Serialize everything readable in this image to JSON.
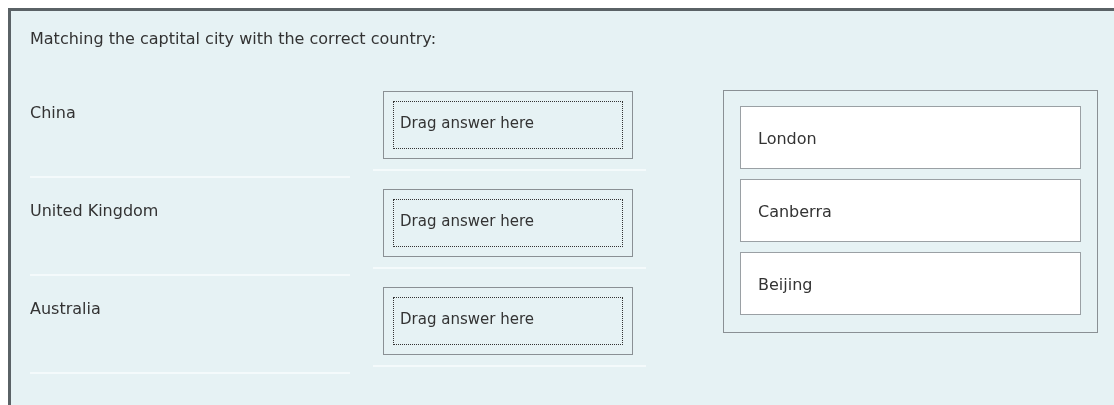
{
  "prompt": "Matching the captital city with the correct country:",
  "rows": [
    {
      "country": "China",
      "drop_zone": "Drag answer here"
    },
    {
      "country": "United Kingdom",
      "drop_zone": "Drag answer here"
    },
    {
      "country": "Australia",
      "drop_zone": "Drag answer here"
    }
  ],
  "answers": [
    "London",
    "Canberra",
    "Beijing"
  ]
}
